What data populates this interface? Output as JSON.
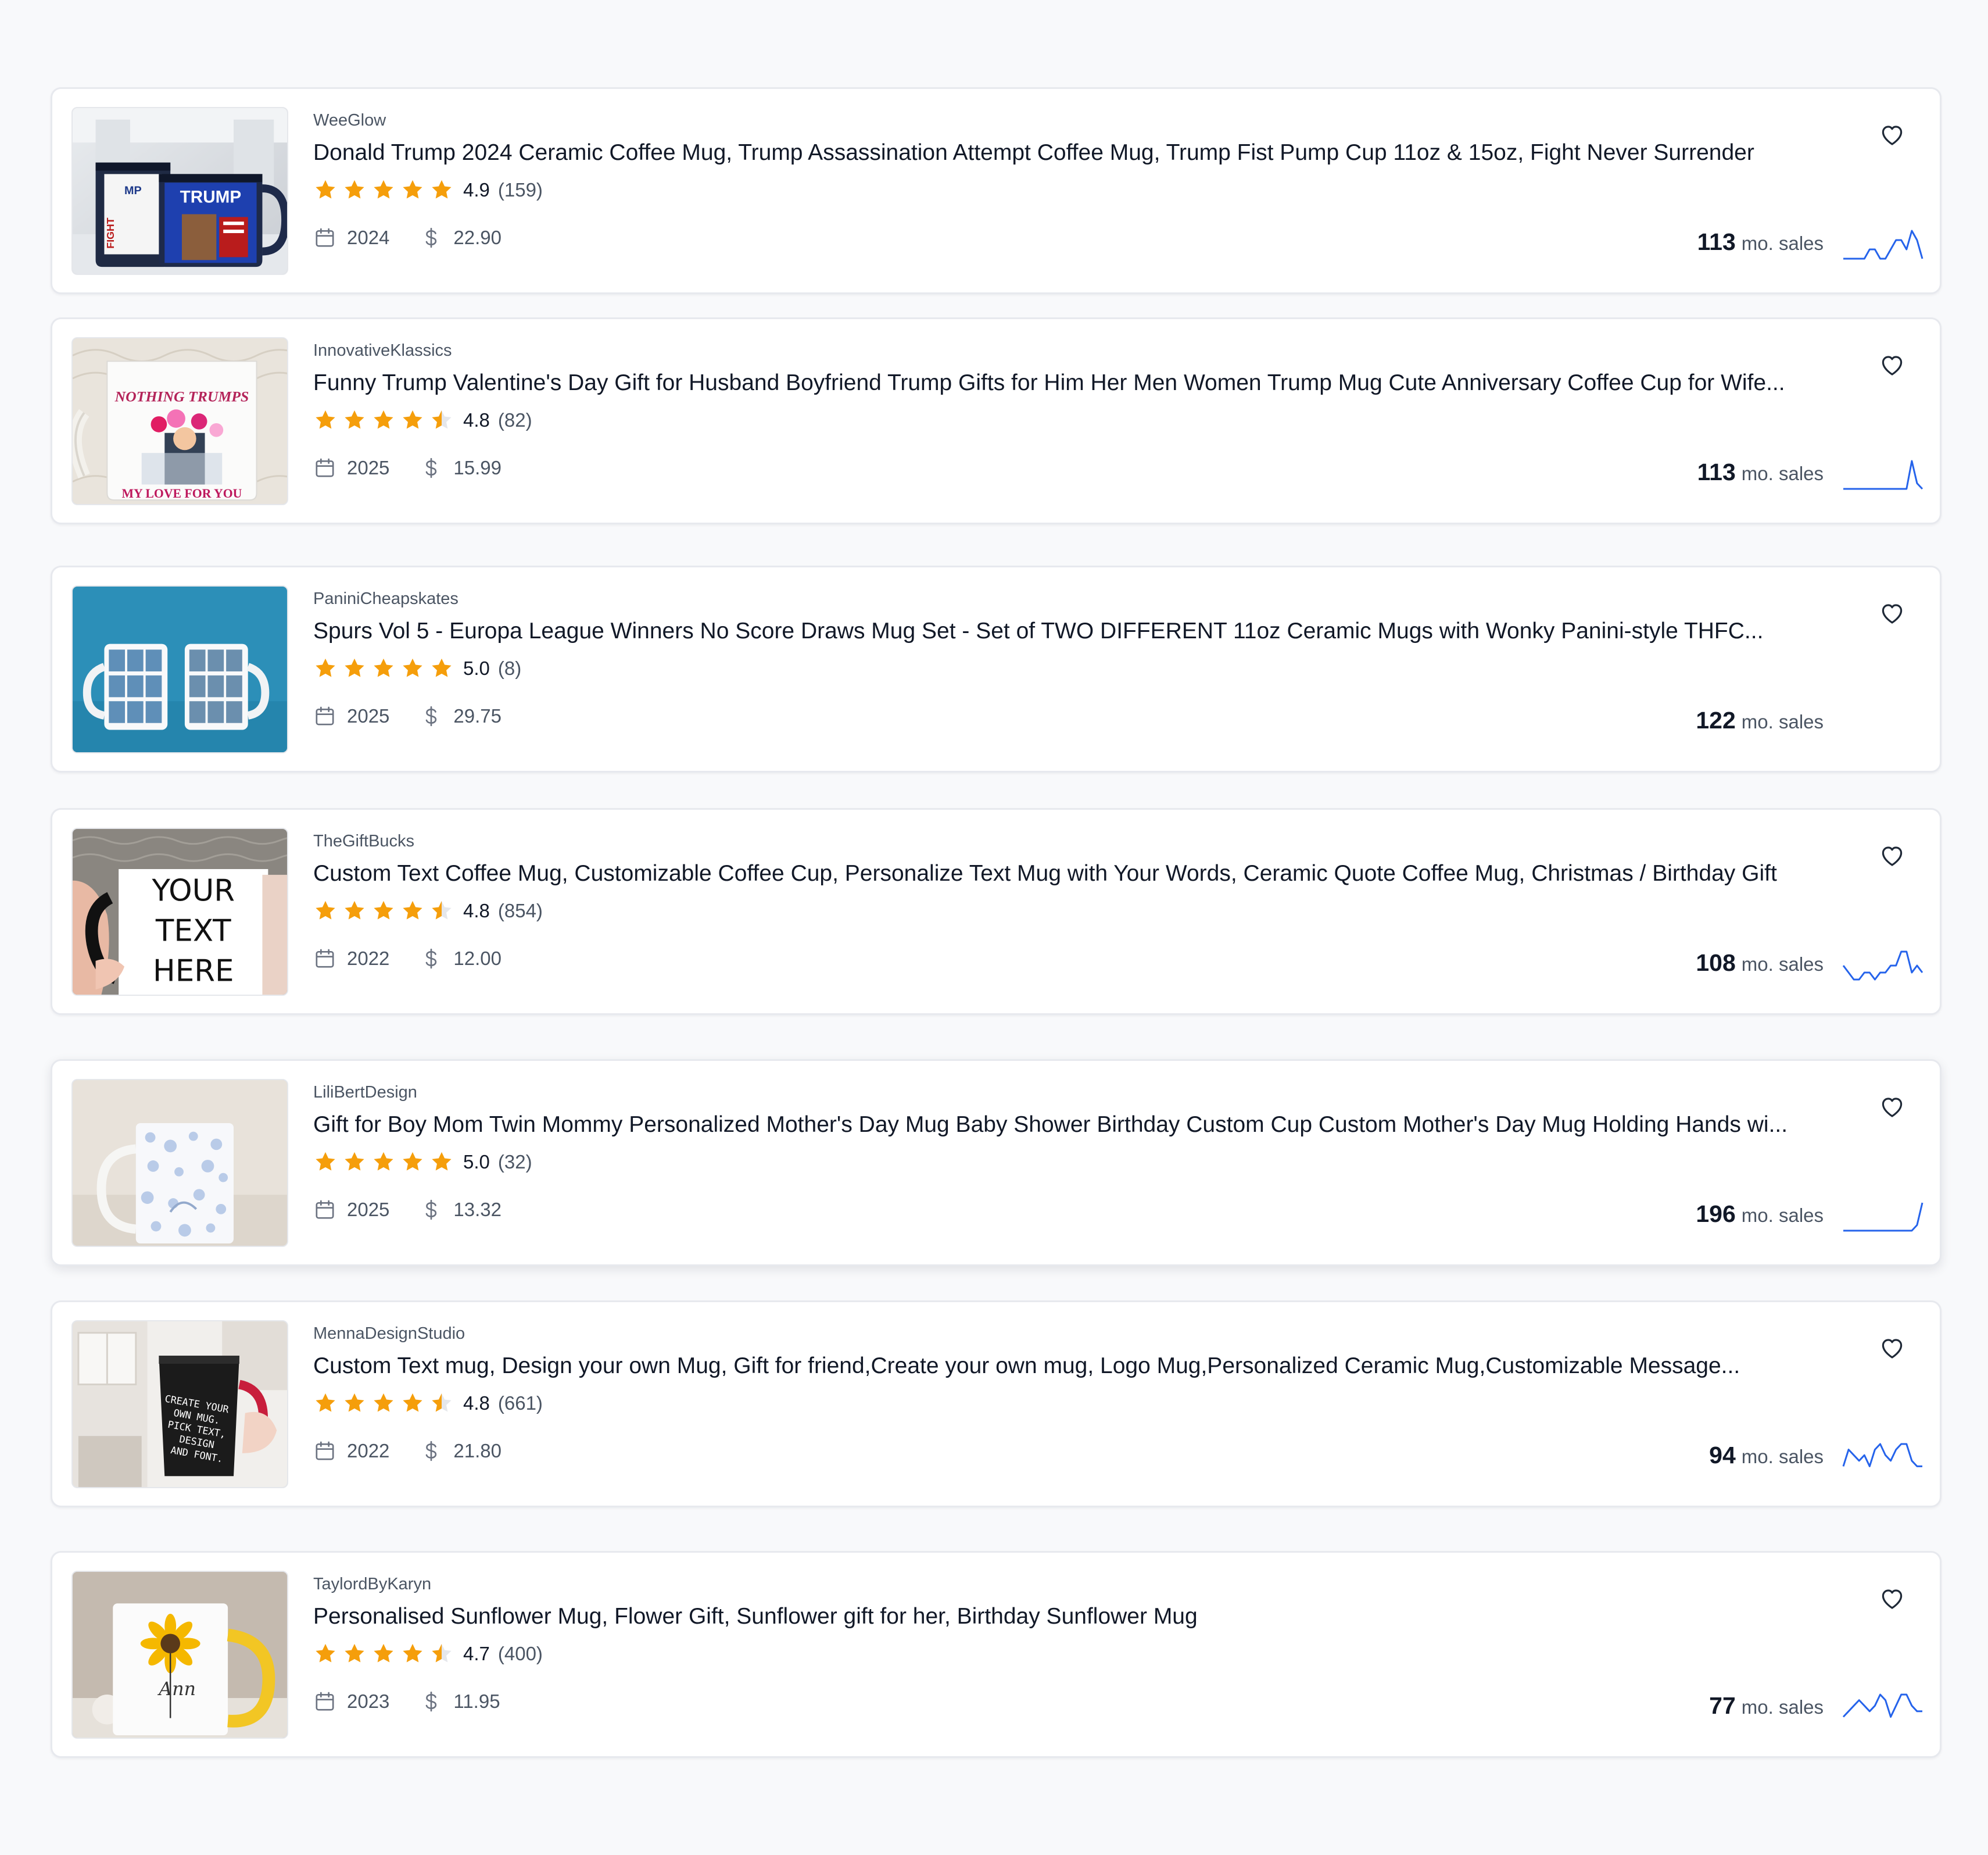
{
  "products": [
    {
      "shop": "WeeGlow",
      "title": "Donald Trump 2024 Ceramic Coffee Mug, Trump Assassination Attempt Coffee Mug, Trump Fist Pump Cup 11oz & 15oz, Fight Never Surrender",
      "rating": "4.9",
      "rating_stars": 4.9,
      "reviews": "(159)",
      "year": "2024",
      "price": "22.90",
      "monthly_sales": "113",
      "sales_label": "mo. sales",
      "sparkline": [
        0,
        0,
        0,
        0,
        0,
        1,
        1,
        0,
        0,
        1,
        2,
        2,
        1,
        3,
        2,
        0
      ],
      "image": "trump-mugs-photo"
    },
    {
      "shop": "InnovativeKlassics",
      "title": "Funny Trump Valentine's Day Gift for Husband Boyfriend Trump Gifts for Him Her Men Women Trump Mug Cute Anniversary Coffee Cup for Wife...",
      "rating": "4.8",
      "rating_stars": 4.8,
      "reviews": "(82)",
      "year": "2025",
      "price": "15.99",
      "monthly_sales": "113",
      "sales_label": "mo. sales",
      "sparkline": [
        0,
        0,
        0,
        0,
        0,
        0,
        0,
        0,
        0,
        0,
        0,
        0,
        0,
        5,
        1,
        0
      ],
      "image": "valentine-trump-mug-photo"
    },
    {
      "shop": "PaniniCheapskates",
      "title": "Spurs Vol 5 - Europa League Winners No Score Draws Mug Set - Set of TWO DIFFERENT 11oz Ceramic Mugs with Wonky Panini-style THFC...",
      "rating": "5.0",
      "rating_stars": 5.0,
      "reviews": "(8)",
      "year": "2025",
      "price": "29.75",
      "monthly_sales": "122",
      "sales_label": "mo. sales",
      "sparkline": [],
      "image": "panini-mug-set-photo"
    },
    {
      "shop": "TheGiftBucks",
      "title": "Custom Text Coffee Mug, Customizable Coffee Cup, Personalize Text Mug with Your Words, Ceramic Quote Coffee Mug, Christmas / Birthday Gift",
      "rating": "4.8",
      "rating_stars": 4.8,
      "reviews": "(854)",
      "year": "2022",
      "price": "12.00",
      "monthly_sales": "108",
      "sales_label": "mo. sales",
      "sparkline": [
        2,
        1,
        0,
        0,
        1,
        1,
        0,
        1,
        1,
        2,
        2,
        4,
        4,
        1,
        2,
        1
      ],
      "image": "your-text-here-mug-photo",
      "mug_text": [
        "YOUR",
        "TEXT",
        "HERE"
      ]
    },
    {
      "shop": "LiliBertDesign",
      "title": "Gift for Boy Mom Twin Mommy Personalized Mother's Day Mug Baby Shower Birthday Custom Cup Custom Mother's Day Mug Holding Hands wi...",
      "rating": "5.0",
      "rating_stars": 5.0,
      "reviews": "(32)",
      "year": "2025",
      "price": "13.32",
      "monthly_sales": "196",
      "sales_label": "mo. sales",
      "sparkline": [
        0,
        0,
        0,
        0,
        0,
        0,
        0,
        0,
        0,
        0,
        0,
        0,
        0,
        0,
        1,
        5
      ],
      "image": "floral-mothers-day-mug-photo"
    },
    {
      "shop": "MennaDesignStudio",
      "title": "Custom Text mug, Design your own Mug, Gift for friend,Create your own mug, Logo Mug,Personalized Ceramic Mug,Customizable Message...",
      "rating": "4.8",
      "rating_stars": 4.8,
      "reviews": "(661)",
      "year": "2022",
      "price": "21.80",
      "monthly_sales": "94",
      "sales_label": "mo. sales",
      "sparkline": [
        1,
        4,
        3,
        2,
        3,
        1,
        4,
        5,
        3,
        2,
        4,
        5,
        5,
        2,
        1,
        1
      ],
      "image": "create-your-own-mug-photo",
      "mug_text": [
        "CREATE YOUR",
        "OWN MUG.",
        "PICK TEXT,",
        "DESIGN",
        "AND FONT."
      ]
    },
    {
      "shop": "TaylordByKaryn",
      "title": "Personalised Sunflower Mug, Flower Gift, Sunflower gift for her, Birthday Sunflower Mug",
      "rating": "4.7",
      "rating_stars": 4.7,
      "reviews": "(400)",
      "year": "2023",
      "price": "11.95",
      "monthly_sales": "77",
      "sales_label": "mo. sales",
      "sparkline": [
        1,
        2,
        3,
        4,
        3,
        2,
        3,
        5,
        4,
        1,
        3,
        5,
        5,
        3,
        2,
        2
      ],
      "image": "sunflower-mug-photo",
      "mug_text": [
        "Ann"
      ]
    }
  ],
  "colors": {
    "accent": "#2563eb",
    "star": "#f59e0b",
    "text": "#111827",
    "muted": "#4b5563",
    "background": "#f8f9fb",
    "card": "#ffffff"
  },
  "icons": {
    "calendar": "calendar-icon",
    "price": "dollar-icon",
    "favorite": "heart-icon",
    "rating": "star-icon",
    "trend": "sparkline-chart"
  }
}
